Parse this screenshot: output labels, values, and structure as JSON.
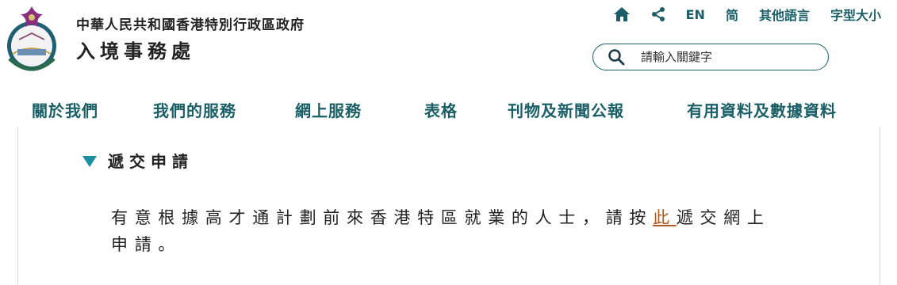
{
  "header": {
    "gov_name": "中華人民共和國香港特別行政區政府",
    "dept_name": "入境事務處"
  },
  "toolbar": {
    "home_icon": "home-icon",
    "share_icon": "share-icon",
    "en": "EN",
    "sc": "简",
    "other_lang": "其他語言",
    "font_size": "字型大小"
  },
  "search": {
    "placeholder": "請輸入關鍵字"
  },
  "nav": {
    "items": [
      "關於我們",
      "我們的服務",
      "網上服務",
      "表格",
      "刊物及新聞公報",
      "有用資料及數據資料"
    ]
  },
  "content": {
    "section_title": "遞交申請",
    "para_before": "有意根據高才通計劃前來香港特區就業的人士，請按",
    "link_text": "此",
    "para_after": "遞交網上申請。"
  },
  "colors": {
    "accent": "#1a5f67",
    "triangle": "#1b8fa5",
    "link": "#b25b25"
  }
}
